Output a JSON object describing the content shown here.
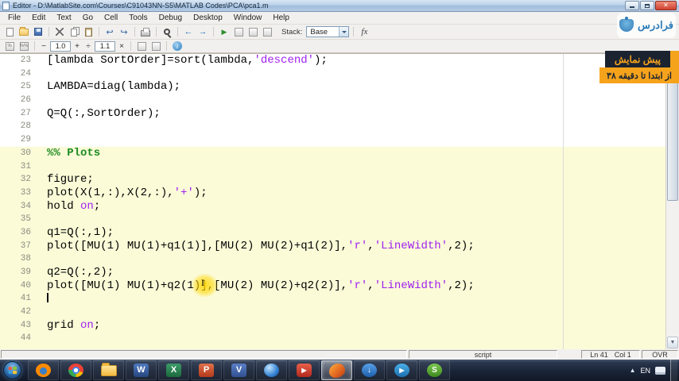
{
  "window": {
    "title": "Editor - D:\\MatlabSite.com\\Courses\\C91043NN-S5\\MATLAB Codes\\PCA\\pca1.m",
    "close_glyph": "✕"
  },
  "menu": {
    "items": [
      "File",
      "Edit",
      "Text",
      "Go",
      "Cell",
      "Tools",
      "Debug",
      "Desktop",
      "Window",
      "Help"
    ]
  },
  "toolbar": {
    "stack_label": "Stack:",
    "stack_value": "Base",
    "fx_label": "fx",
    "undo_glyph": "↩",
    "redo_glyph": "↪",
    "back_glyph": "←",
    "forward_glyph": "→",
    "run_glyph": "▶"
  },
  "cell_toolbar": {
    "minus": "−",
    "val1": "1.0",
    "plus": "+",
    "divide": "÷",
    "val2": "1.1",
    "multiply": "×",
    "info_glyph": "i"
  },
  "editor": {
    "colors": {
      "cell_background": "#fbfbd8",
      "string": "#a020f0",
      "comment": "#1e8b22"
    },
    "lines": [
      {
        "num": "23",
        "cell": false,
        "segs": [
          [
            "code",
            "[lambda SortOrder]=sort(lambda,"
          ],
          [
            "str",
            "'descend'"
          ],
          [
            "code",
            ");"
          ]
        ]
      },
      {
        "num": "24",
        "cell": false,
        "segs": []
      },
      {
        "num": "25",
        "cell": false,
        "segs": [
          [
            "code",
            "LAMBDA=diag(lambda);"
          ]
        ]
      },
      {
        "num": "26",
        "cell": false,
        "segs": []
      },
      {
        "num": "27",
        "cell": false,
        "segs": [
          [
            "code",
            "Q=Q(:,SortOrder);"
          ]
        ]
      },
      {
        "num": "28",
        "cell": false,
        "segs": []
      },
      {
        "num": "29",
        "cell": false,
        "segs": []
      },
      {
        "num": "30",
        "cell": true,
        "segs": [
          [
            "com",
            "%% Plots"
          ]
        ]
      },
      {
        "num": "31",
        "cell": true,
        "segs": []
      },
      {
        "num": "32",
        "cell": true,
        "segs": [
          [
            "code",
            "figure;"
          ]
        ]
      },
      {
        "num": "33",
        "cell": true,
        "segs": [
          [
            "code",
            "plot(X(1,:),X(2,:),"
          ],
          [
            "str",
            "'+'"
          ],
          [
            "code",
            ");"
          ]
        ]
      },
      {
        "num": "34",
        "cell": true,
        "segs": [
          [
            "code",
            "hold "
          ],
          [
            "str",
            "on"
          ],
          [
            "code",
            ";"
          ]
        ]
      },
      {
        "num": "35",
        "cell": true,
        "segs": []
      },
      {
        "num": "36",
        "cell": true,
        "segs": [
          [
            "code",
            "q1=Q(:,1);"
          ]
        ]
      },
      {
        "num": "37",
        "cell": true,
        "segs": [
          [
            "code",
            "plot([MU(1) MU(1)+q1(1)],[MU(2) MU(2)+q1(2)],"
          ],
          [
            "str",
            "'r'"
          ],
          [
            "code",
            ","
          ],
          [
            "str",
            "'LineWidth'"
          ],
          [
            "code",
            ",2);"
          ]
        ]
      },
      {
        "num": "38",
        "cell": true,
        "segs": []
      },
      {
        "num": "39",
        "cell": true,
        "segs": [
          [
            "code",
            "q2=Q(:,2);"
          ]
        ]
      },
      {
        "num": "40",
        "cell": true,
        "segs": [
          [
            "code",
            "plot([MU(1) MU(1)+q2(1)],[MU(2) MU(2)+q2(2)],"
          ],
          [
            "str",
            "'r'"
          ],
          [
            "code",
            ","
          ],
          [
            "str",
            "'LineWidth'"
          ],
          [
            "code",
            ",2);"
          ]
        ]
      },
      {
        "num": "41",
        "cell": true,
        "caret": true,
        "segs": []
      },
      {
        "num": "42",
        "cell": true,
        "segs": []
      },
      {
        "num": "43",
        "cell": true,
        "segs": [
          [
            "code",
            "grid "
          ],
          [
            "str",
            "on"
          ],
          [
            "code",
            ";"
          ]
        ]
      },
      {
        "num": "44",
        "cell": true,
        "segs": []
      }
    ]
  },
  "statusbar": {
    "file_type": "script",
    "line": "Ln 41",
    "col": "Col 1",
    "mode": "OVR"
  },
  "taskbar": {
    "language": "EN",
    "apps": [
      {
        "name": "firefox"
      },
      {
        "name": "chrome"
      },
      {
        "name": "explorer"
      },
      {
        "name": "word",
        "glyph": "W"
      },
      {
        "name": "excel",
        "glyph": "X"
      },
      {
        "name": "powerpoint",
        "glyph": "P"
      },
      {
        "name": "visio",
        "glyph": "V"
      },
      {
        "name": "internet"
      },
      {
        "name": "media-red",
        "glyph": "▶"
      },
      {
        "name": "matlab",
        "active": true
      },
      {
        "name": "idm",
        "glyph": "↓"
      },
      {
        "name": "player-blue",
        "glyph": "▶"
      },
      {
        "name": "snagit",
        "glyph": "S"
      }
    ]
  },
  "watermark": {
    "brand": "فرادرس",
    "badge_preview": "پیش نمایش",
    "badge_range": "از ابتدا تا دقیقه ۳۸"
  }
}
